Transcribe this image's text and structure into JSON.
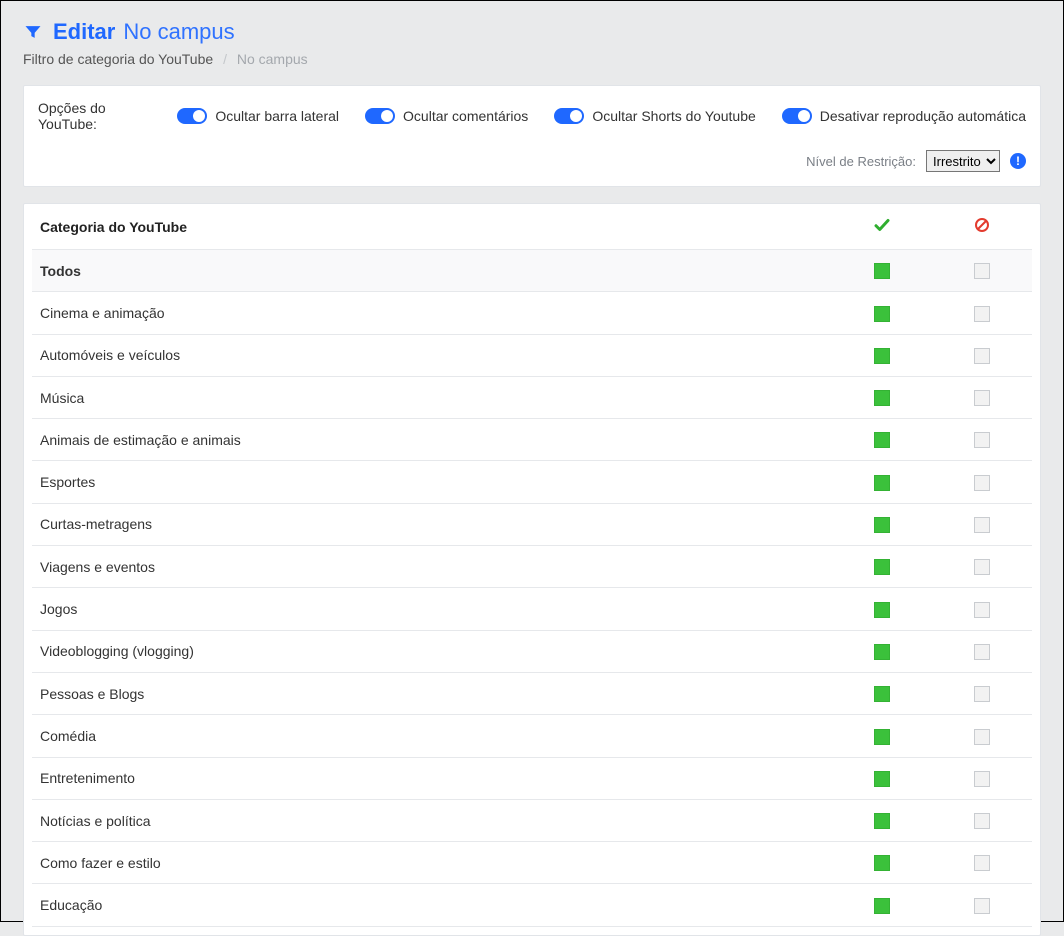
{
  "header": {
    "title_bold": "Editar",
    "title_thin": "No campus"
  },
  "breadcrumb": {
    "root": "Filtro de categoria do YouTube",
    "current": "No campus"
  },
  "options": {
    "label": "Opções do YouTube:",
    "toggles": [
      {
        "id": "hide-sidebar",
        "label": "Ocultar barra lateral",
        "on": true
      },
      {
        "id": "hide-comments",
        "label": "Ocultar comentários",
        "on": true
      },
      {
        "id": "hide-shorts",
        "label": "Ocultar Shorts do Youtube",
        "on": true
      },
      {
        "id": "disable-autoplay",
        "label": "Desativar reprodução automática",
        "on": true
      }
    ],
    "restriction_label": "Nível de Restrição:",
    "restriction_selected": "Irrestrito"
  },
  "table": {
    "header_category": "Categoria do YouTube",
    "rows": [
      {
        "label": "Todos",
        "allow": true,
        "block": false,
        "all": true
      },
      {
        "label": "Cinema e animação",
        "allow": true,
        "block": false
      },
      {
        "label": "Automóveis e veículos",
        "allow": true,
        "block": false
      },
      {
        "label": "Música",
        "allow": true,
        "block": false
      },
      {
        "label": "Animais de estimação e animais",
        "allow": true,
        "block": false
      },
      {
        "label": "Esportes",
        "allow": true,
        "block": false
      },
      {
        "label": "Curtas-metragens",
        "allow": true,
        "block": false
      },
      {
        "label": "Viagens e eventos",
        "allow": true,
        "block": false
      },
      {
        "label": "Jogos",
        "allow": true,
        "block": false
      },
      {
        "label": "Videoblogging (vlogging)",
        "allow": true,
        "block": false
      },
      {
        "label": "Pessoas e Blogs",
        "allow": true,
        "block": false
      },
      {
        "label": "Comédia",
        "allow": true,
        "block": false
      },
      {
        "label": "Entretenimento",
        "allow": true,
        "block": false
      },
      {
        "label": "Notícias e política",
        "allow": true,
        "block": false
      },
      {
        "label": "Como fazer e estilo",
        "allow": true,
        "block": false
      },
      {
        "label": "Educação",
        "allow": true,
        "block": false
      }
    ]
  }
}
